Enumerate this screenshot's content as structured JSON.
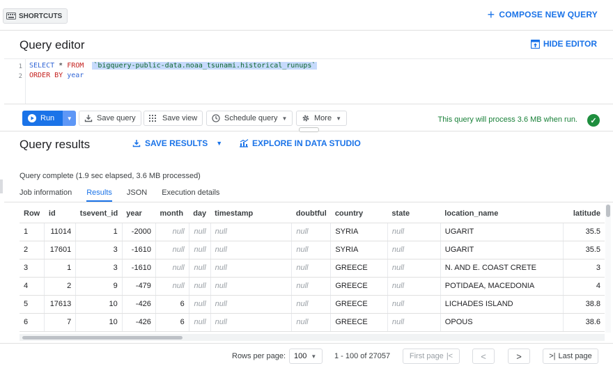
{
  "topbar": {
    "shortcuts_label": "SHORTCUTS",
    "compose_label": "COMPOSE NEW QUERY"
  },
  "editor": {
    "title": "Query editor",
    "hide_label": "HIDE EDITOR",
    "line_numbers": [
      "1",
      "2"
    ],
    "kw_select": "SELECT",
    "star": " * ",
    "kw_from": "FROM",
    "table_ref": "`bigquery-public-data.noaa_tsunami.historical_runups`",
    "kw_order": "ORDER BY",
    "order_field": "year"
  },
  "toolbar": {
    "run_label": "Run",
    "save_query_label": "Save query",
    "save_view_label": "Save view",
    "schedule_label": "Schedule query",
    "more_label": "More",
    "process_text": "This query will process 3.6 MB when run."
  },
  "results": {
    "title": "Query results",
    "save_results_label": "SAVE RESULTS",
    "explore_label": "EXPLORE IN DATA STUDIO",
    "complete_text": "Query complete (1.9 sec elapsed, 3.6 MB processed)",
    "tabs": [
      "Job information",
      "Results",
      "JSON",
      "Execution details"
    ],
    "active_tab": "Results",
    "columns": [
      "Row",
      "id",
      "tsevent_id",
      "year",
      "month",
      "day",
      "timestamp",
      "doubtful",
      "country",
      "state",
      "location_name",
      "latitude"
    ],
    "rows": [
      [
        "1",
        "11014",
        "1",
        "-2000",
        "null",
        "null",
        "null",
        "null",
        "SYRIA",
        "null",
        "UGARIT",
        "35.5"
      ],
      [
        "2",
        "17601",
        "3",
        "-1610",
        "null",
        "null",
        "null",
        "null",
        "SYRIA",
        "null",
        "UGARIT",
        "35.5"
      ],
      [
        "3",
        "1",
        "3",
        "-1610",
        "null",
        "null",
        "null",
        "null",
        "GREECE",
        "null",
        "N. AND E. COAST CRETE",
        "3"
      ],
      [
        "4",
        "2",
        "9",
        "-479",
        "null",
        "null",
        "null",
        "null",
        "GREECE",
        "null",
        "POTIDAEA, MACEDONIA",
        "4"
      ],
      [
        "5",
        "17613",
        "10",
        "-426",
        "6",
        "null",
        "null",
        "null",
        "GREECE",
        "null",
        "LICHADES ISLAND",
        "38.8"
      ],
      [
        "6",
        "7",
        "10",
        "-426",
        "6",
        "null",
        "null",
        "null",
        "GREECE",
        "null",
        "OPOUS",
        "38.6"
      ]
    ]
  },
  "footer": {
    "rows_per_page_label": "Rows per page:",
    "rows_per_page_value": "100",
    "range_text": "1 - 100 of 27057",
    "first_page_label": "First page",
    "last_page_label": "Last page"
  }
}
